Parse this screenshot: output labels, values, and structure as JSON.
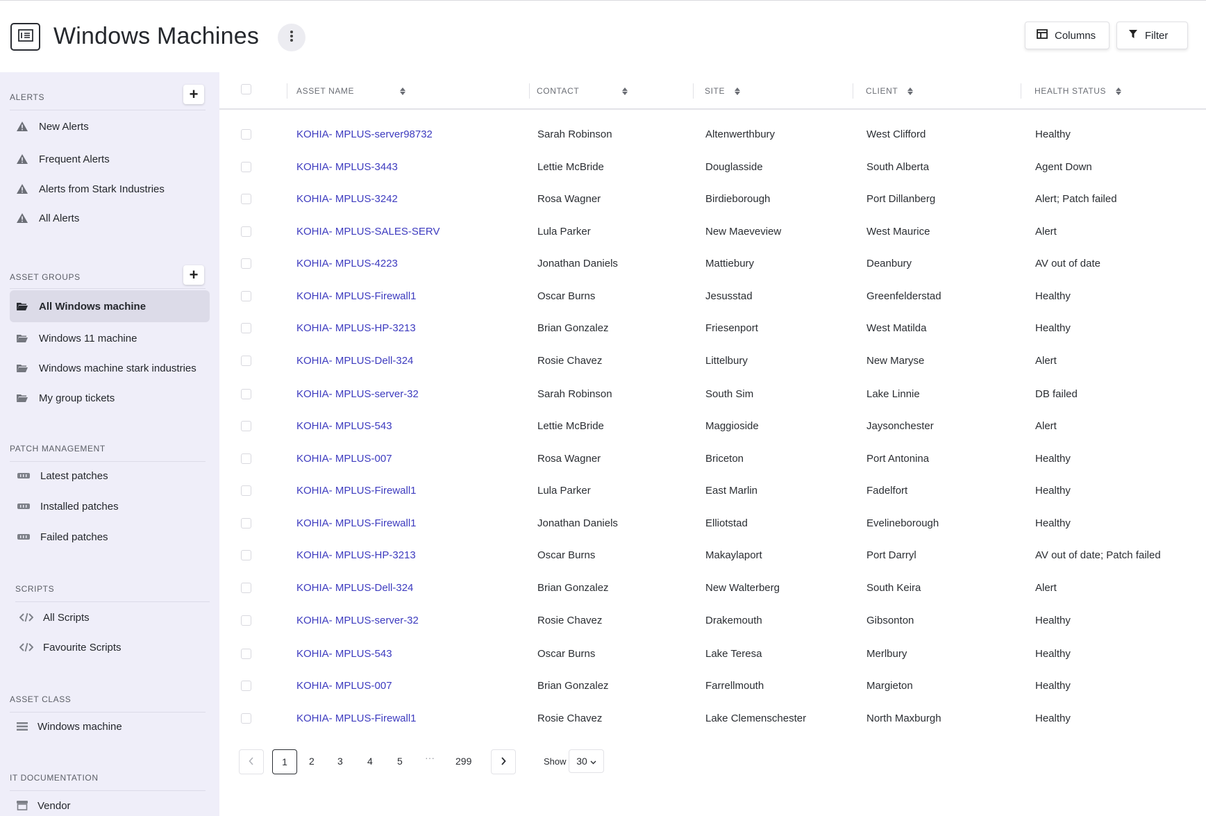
{
  "header": {
    "title": "Windows Machines",
    "columns_label": "Columns",
    "filter_label": "Filter"
  },
  "sidebar": {
    "alerts": {
      "heading": "ALERTS",
      "items": [
        "New Alerts",
        "Frequent Alerts",
        "Alerts from Stark Industries",
        "All Alerts"
      ]
    },
    "asset_groups": {
      "heading": "ASSET GROUPS",
      "items": [
        "All Windows machine",
        "Windows 11 machine",
        "Windows machine stark industries",
        "My group tickets"
      ],
      "active_index": 0
    },
    "patch_management": {
      "heading": "PATCH MANAGEMENT",
      "items": [
        "Latest patches",
        "Installed patches",
        "Failed patches"
      ]
    },
    "scripts": {
      "heading": "SCRIPTS",
      "items": [
        "All Scripts",
        "Favourite Scripts"
      ]
    },
    "asset_class": {
      "heading": "ASSET CLASS",
      "items": [
        "Windows machine"
      ]
    },
    "it_documentation": {
      "heading": "IT DOCUMENTATION",
      "items": [
        "Vendor"
      ]
    }
  },
  "table": {
    "columns": [
      "ASSET NAME",
      "CONTACT",
      "SITE",
      "CLIENT",
      "HEALTH STATUS"
    ],
    "rows": [
      {
        "asset": "KOHIA- MPLUS-server98732",
        "contact": "Sarah Robinson",
        "site": "Altenwerthbury",
        "client": "West Clifford",
        "health": "Healthy"
      },
      {
        "asset": "KOHIA- MPLUS-3443",
        "contact": "Lettie McBride",
        "site": "Douglasside",
        "client": "South Alberta",
        "health": "Agent Down"
      },
      {
        "asset": "KOHIA- MPLUS-3242",
        "contact": "Rosa Wagner",
        "site": "Birdieborough",
        "client": "Port Dillanberg",
        "health": "Alert; Patch failed"
      },
      {
        "asset": "KOHIA- MPLUS-SALES-SERV",
        "contact": "Lula Parker",
        "site": "New Maeveview",
        "client": "West Maurice",
        "health": "Alert"
      },
      {
        "asset": "KOHIA- MPLUS-4223",
        "contact": "Jonathan Daniels",
        "site": "Mattiebury",
        "client": "Deanbury",
        "health": "AV out of date"
      },
      {
        "asset": "KOHIA- MPLUS-Firewall1",
        "contact": "Oscar Burns",
        "site": "Jesusstad",
        "client": "Greenfelderstad",
        "health": "Healthy"
      },
      {
        "asset": "KOHIA- MPLUS-HP-3213",
        "contact": "Brian Gonzalez",
        "site": "Friesenport",
        "client": "West Matilda",
        "health": "Healthy"
      },
      {
        "asset": "KOHIA- MPLUS-Dell-324",
        "contact": "Rosie Chavez",
        "site": "Littelbury",
        "client": "New Maryse",
        "health": "Alert"
      },
      {
        "asset": "KOHIA- MPLUS-server-32",
        "contact": "Sarah Robinson",
        "site": "South Sim",
        "client": "Lake Linnie",
        "health": "DB failed"
      },
      {
        "asset": "KOHIA- MPLUS-543",
        "contact": "Lettie McBride",
        "site": "Maggioside",
        "client": "Jaysonchester",
        "health": "Alert"
      },
      {
        "asset": "KOHIA- MPLUS-007",
        "contact": "Rosa Wagner",
        "site": "Briceton",
        "client": "Port Antonina",
        "health": "Healthy"
      },
      {
        "asset": "KOHIA- MPLUS-Firewall1",
        "contact": "Lula Parker",
        "site": "East Marlin",
        "client": "Fadelfort",
        "health": "Healthy"
      },
      {
        "asset": "KOHIA- MPLUS-Firewall1",
        "contact": "Jonathan Daniels",
        "site": "Elliotstad",
        "client": "Evelineborough",
        "health": "Healthy"
      },
      {
        "asset": "KOHIA- MPLUS-HP-3213",
        "contact": "Oscar Burns",
        "site": "Makaylaport",
        "client": "Port Darryl",
        "health": "AV out of date; Patch failed"
      },
      {
        "asset": "KOHIA- MPLUS-Dell-324",
        "contact": "Brian Gonzalez",
        "site": "New Walterberg",
        "client": "South Keira",
        "health": "Alert"
      },
      {
        "asset": "KOHIA- MPLUS-server-32",
        "contact": "Rosie Chavez",
        "site": "Drakemouth",
        "client": "Gibsonton",
        "health": "Healthy"
      },
      {
        "asset": "KOHIA- MPLUS-543",
        "contact": "Oscar Burns",
        "site": "Lake Teresa",
        "client": "Merlbury",
        "health": "Healthy"
      },
      {
        "asset": "KOHIA- MPLUS-007",
        "contact": "Brian Gonzalez",
        "site": "Farrellmouth",
        "client": "Margieton",
        "health": "Healthy"
      },
      {
        "asset": "KOHIA- MPLUS-Firewall1",
        "contact": "Rosie Chavez",
        "site": "Lake Clemenschester",
        "client": "North Maxburgh",
        "health": "Healthy"
      }
    ]
  },
  "pagination": {
    "pages": [
      "1",
      "2",
      "3",
      "4",
      "5"
    ],
    "current": "1",
    "ellipsis": "···",
    "last_page": "299",
    "show_label": "Show",
    "page_size": "30"
  }
}
